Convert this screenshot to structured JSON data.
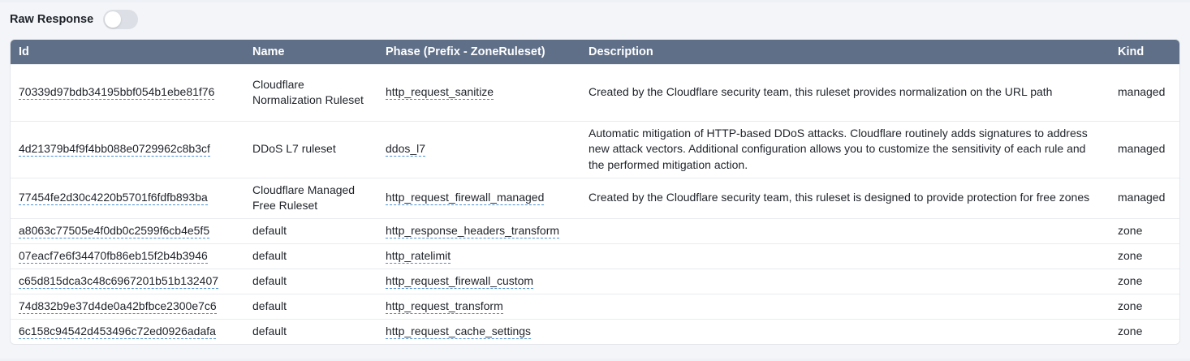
{
  "toolbar": {
    "raw_response_label": "Raw Response",
    "raw_response_enabled": false
  },
  "table": {
    "headers": {
      "id": "Id",
      "name": "Name",
      "phase": "Phase (Prefix - ZoneRuleset)",
      "description": "Description",
      "kind": "Kind"
    },
    "rows": [
      {
        "id": "70339d97bdb34195bbf054b1ebe81f76",
        "name": "Cloudflare Normalization Ruleset",
        "phase": "http_request_sanitize",
        "description": "Created by the Cloudflare security team, this ruleset provides normalization on the URL path",
        "kind": "managed"
      },
      {
        "id": "4d21379b4f9f4bb088e0729962c8b3cf",
        "name": "DDoS L7 ruleset",
        "phase": "ddos_l7",
        "description": "Automatic mitigation of HTTP-based DDoS attacks. Cloudflare routinely adds signatures to address new attack vectors. Additional configuration allows you to customize the sensitivity of each rule and the performed mitigation action.",
        "kind": "managed"
      },
      {
        "id": "77454fe2d30c4220b5701f6fdfb893ba",
        "name": "Cloudflare Managed Free Ruleset",
        "phase": "http_request_firewall_managed",
        "description": "Created by the Cloudflare security team, this ruleset is designed to provide protection for free zones",
        "kind": "managed"
      },
      {
        "id": "a8063c77505e4f0db0c2599f6cb4e5f5",
        "name": "default",
        "phase": "http_response_headers_transform",
        "description": "",
        "kind": "zone"
      },
      {
        "id": "07eacf7e6f34470fb86eb15f2b4b3946",
        "name": "default",
        "phase": "http_ratelimit",
        "description": "",
        "kind": "zone"
      },
      {
        "id": "c65d815dca3c48c6967201b51b132407",
        "name": "default",
        "phase": "http_request_firewall_custom",
        "description": "",
        "kind": "zone"
      },
      {
        "id": "74d832b9e37d4de0a42bfbce2300e7c6",
        "name": "default",
        "phase": "http_request_transform",
        "description": "",
        "kind": "zone"
      },
      {
        "id": "6c158c94542d453496c72ed0926adafa",
        "name": "default",
        "phase": "http_request_cache_settings",
        "description": "",
        "kind": "zone"
      }
    ]
  },
  "colors": {
    "header_bg": "#5f6f88",
    "link_underline": "#4a8fd6",
    "page_bg": "#eef1f6"
  }
}
